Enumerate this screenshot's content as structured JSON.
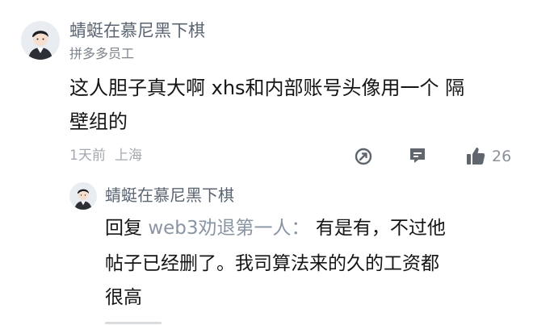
{
  "comment": {
    "author": "蜻蜓在慕尼黑下棋",
    "tag": "拼多多员工",
    "text_line1": "这人胆子真大啊 xhs和内部账号头像用一个 隔",
    "text_line2": "壁组的",
    "time": "1天前",
    "location": "上海",
    "like_count": "26"
  },
  "reply": {
    "author": "蜻蜓在慕尼黑下棋",
    "prefix": "回复",
    "target": "web3劝退第一人",
    "separator": "：",
    "text_line1": "有是有，不过他",
    "text_line2": "帖子已经删了。我司算法来的久的工资都",
    "text_line3": "很高"
  },
  "icons": {
    "share": "share-icon",
    "reply": "comment-icon",
    "like": "thumbs-up-icon"
  }
}
